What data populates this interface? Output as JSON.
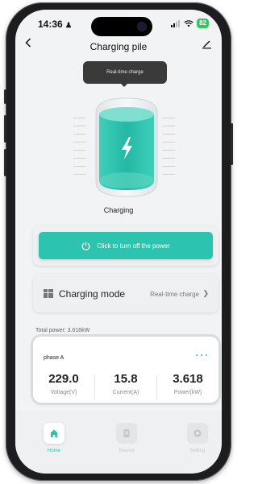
{
  "status_bar": {
    "time": "14:36",
    "battery": "82"
  },
  "nav": {
    "title": "Charging pile"
  },
  "tooltip": {
    "text": "Real-time charge"
  },
  "charger": {
    "status": "Charging"
  },
  "power_button": {
    "label": "Click to turn off the power"
  },
  "charging_mode": {
    "label": "Charging mode",
    "value": "Real-time charge"
  },
  "total_power": {
    "text": "Total power: 3.618kW"
  },
  "phase": {
    "name": "phase A",
    "metrics": [
      {
        "value": "229.0",
        "label": "Voltage(V)"
      },
      {
        "value": "15.8",
        "label": "Current(A)"
      },
      {
        "value": "3.618",
        "label": "Power(kW)"
      }
    ]
  },
  "tabs": [
    {
      "label": "Home",
      "icon": "home-icon",
      "active": true
    },
    {
      "label": "Record",
      "icon": "record-icon",
      "active": false
    },
    {
      "label": "Setting",
      "icon": "setting-icon",
      "active": false
    }
  ],
  "colors": {
    "accent": "#2cc4ae",
    "screen_bg": "#f2f3f4",
    "tooltip_bg": "#3a3a3a",
    "inactive": "#c6c9cc"
  }
}
